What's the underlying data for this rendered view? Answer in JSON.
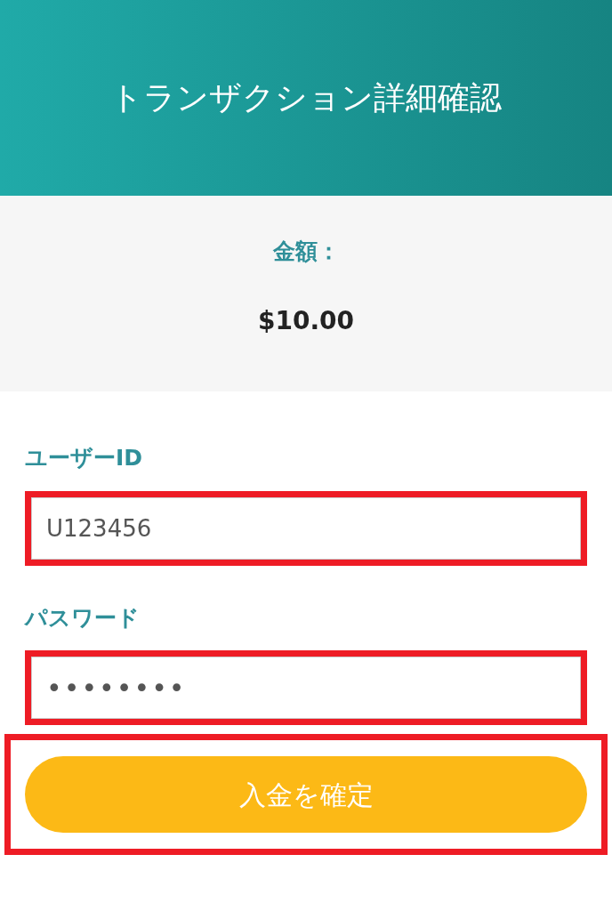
{
  "header": {
    "title": "トランザクション詳細確認"
  },
  "amount": {
    "label": "金額：",
    "value": "$10.00"
  },
  "fields": [
    {
      "label": "ユーザーID",
      "value": "U123456",
      "kind": "text",
      "highlighted": true
    },
    {
      "label": "パスワード",
      "value": "••••••••",
      "kind": "password",
      "highlighted": true
    }
  ],
  "submit": {
    "label": "入金を確定",
    "highlighted": true
  }
}
